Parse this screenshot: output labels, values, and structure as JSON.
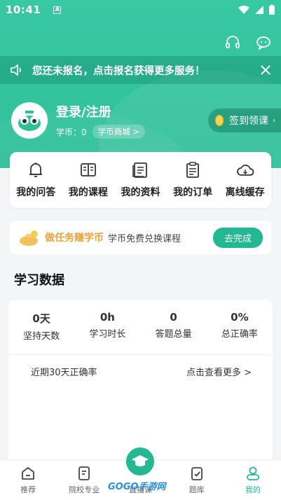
{
  "status_bar": {
    "time": "10:41",
    "a_label": "A"
  },
  "notice": {
    "text": "您还未报名，点击报名获得更多服务！"
  },
  "profile": {
    "name": "登录/注册",
    "coins_label": "学币：",
    "coins_value": "0",
    "mall_button": "学币商城 >"
  },
  "checkin": {
    "label": "签到领课"
  },
  "menu": [
    {
      "label": "我的问答",
      "icon": "bell-icon"
    },
    {
      "label": "我的课程",
      "icon": "book-icon"
    },
    {
      "label": "我的资料",
      "icon": "document-icon"
    },
    {
      "label": "我的订单",
      "icon": "clipboard-icon"
    },
    {
      "label": "离线缓存",
      "icon": "cloud-icon"
    }
  ],
  "task": {
    "title": "做任务赚学币",
    "subtitle": "学币免费兑换课程",
    "button": "去完成"
  },
  "study": {
    "title": "学习数据",
    "stats": [
      {
        "value": "0天",
        "label": "坚持天数"
      },
      {
        "value": "0h",
        "label": "学习时长"
      },
      {
        "value": "0",
        "label": "答题总量"
      },
      {
        "value": "0%",
        "label": "总正确率"
      }
    ],
    "recent_label": "近期30天正确率",
    "more_label": "点击查看更多 >"
  },
  "tabbar": [
    {
      "label": "推荐"
    },
    {
      "label": "院校专业"
    },
    {
      "label": "直播课"
    },
    {
      "label": "题库"
    },
    {
      "label": "我的"
    }
  ],
  "watermark": "GOGO手游网",
  "colors": {
    "primary": "#23b891",
    "hero": "#38c8a3",
    "task_title": "#e8a33a"
  }
}
